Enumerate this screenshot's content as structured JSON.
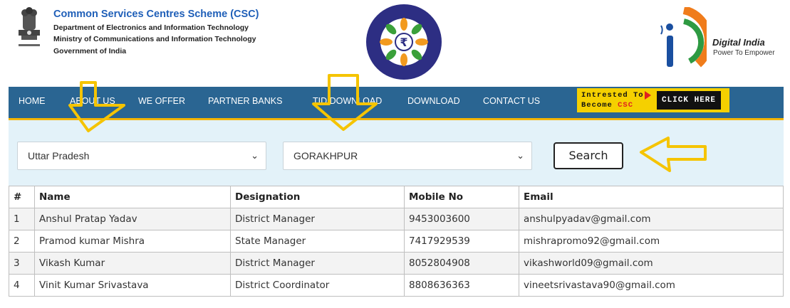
{
  "header": {
    "title": "Common Services Centres Scheme (CSC)",
    "lines": [
      "Department of Electronics and Information Technology",
      "Ministry of Communications and Information Technology",
      "Government of India"
    ],
    "digital_india": "Digital India",
    "digital_india_tagline": "Power To Empower"
  },
  "nav": {
    "items": [
      "HOME",
      "ABOUT US",
      "WE OFFER",
      "PARTNER BANKS",
      "TID DOWNLOAD",
      "DOWNLOAD",
      "CONTACT US"
    ],
    "cta": {
      "line1": "Intrested To",
      "line2_prefix": "Become",
      "line2_highlight": "CSC",
      "button": "CLICK HERE"
    }
  },
  "filters": {
    "state": "Uttar Pradesh",
    "district": "GORAKHPUR",
    "search_label": "Search"
  },
  "table": {
    "headers": [
      "#",
      "Name",
      "Designation",
      "Mobile No",
      "Email"
    ],
    "rows": [
      [
        "1",
        "Anshul Pratap Yadav",
        "District Manager",
        "9453003600",
        "anshulpyadav@gmail.com"
      ],
      [
        "2",
        "Pramod kumar Mishra",
        "State Manager",
        "7417929539",
        "mishrapromo92@gmail.com"
      ],
      [
        "3",
        "Vikash Kumar",
        "District Manager",
        "8052804908",
        "vikashworld09@gmail.com"
      ],
      [
        "4",
        "Vinit Kumar Srivastava",
        "District Coordinator",
        "8808636363",
        "vineetsrivastava90@gmail.com"
      ]
    ]
  },
  "colors": {
    "nav_bg": "#2a6592",
    "accent_yellow": "#f4b400",
    "filter_bg": "#e3f2f9",
    "title_blue": "#1f5fb8"
  }
}
